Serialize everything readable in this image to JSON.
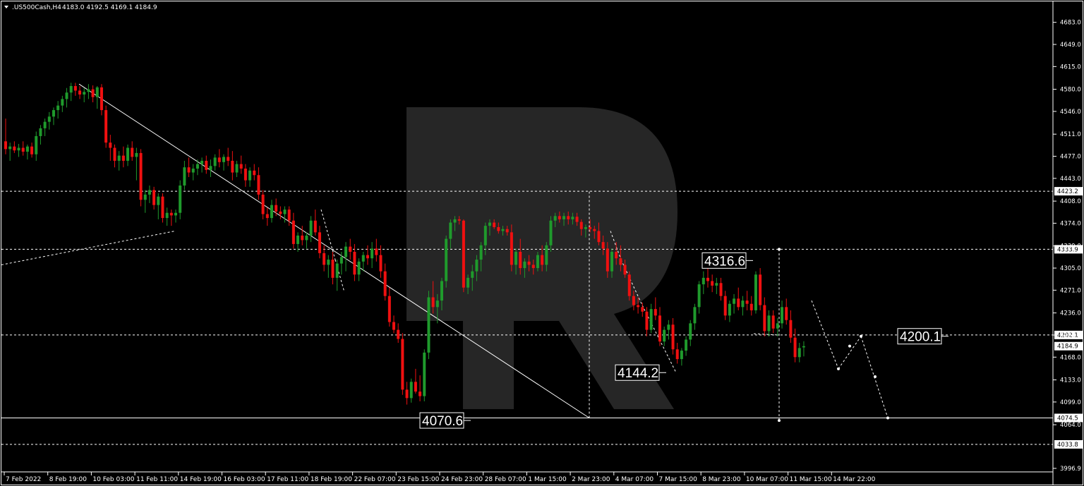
{
  "header": {
    "symbol": ".US500Cash,H4",
    "ohlc": "4183.0 4192.5 4169.1 4184.9"
  },
  "colors": {
    "background": "#000000",
    "bull": "#1f9a2c",
    "bear": "#f01010",
    "line": "#ffffff",
    "tag_bg": "#ffffff"
  },
  "chart_data": {
    "type": "candlestick",
    "timeframe": "H4",
    "ylim": [
      3996.9,
      4700
    ],
    "y_ticks": [
      "4683.0",
      "4649.0",
      "4615.0",
      "4580.0",
      "4546.0",
      "4511.0",
      "4477.0",
      "4443.0",
      "4408.0",
      "4374.0",
      "4339.0",
      "4305.0",
      "4271.0",
      "4236.0",
      "4202.0",
      "4168.0",
      "4133.0",
      "4099.0",
      "4064.0",
      "3996.9"
    ],
    "x_labels": [
      "7 Feb 2022",
      "8 Feb 19:00",
      "10 Feb 03:00",
      "11 Feb 11:00",
      "14 Feb 19:00",
      "16 Feb 03:00",
      "17 Feb 11:00",
      "18 Feb 19:00",
      "22 Feb 07:00",
      "23 Feb 15:00",
      "24 Feb 23:00",
      "28 Feb 07:00",
      "1 Mar 15:00",
      "2 Mar 23:00",
      "4 Mar 07:00",
      "7 Mar 15:00",
      "8 Mar 23:00",
      "10 Mar 07:00",
      "11 Mar 15:00",
      "14 Mar 22:00"
    ],
    "levels": [
      {
        "value": 4423.2,
        "style": "dashed",
        "tag": "4423.2"
      },
      {
        "value": 4333.9,
        "style": "dashed",
        "tag": "4333.9"
      },
      {
        "value": 4202.1,
        "style": "dashed",
        "tag": "4202.1"
      },
      {
        "value": 4074.5,
        "style": "solid",
        "tag": "4074.5"
      },
      {
        "value": 4033.8,
        "style": "dashed",
        "tag": "4033.8"
      }
    ],
    "current_price": {
      "value": 4184.9,
      "tag": "4184.9"
    },
    "annotations": [
      {
        "text": "4316.6",
        "value": 4316.6
      },
      {
        "text": "4200.1",
        "value": 4200.1
      },
      {
        "text": "4144.2",
        "value": 4144.2
      },
      {
        "text": "4070.6",
        "value": 4070.6
      }
    ],
    "candles": [
      [
        4500,
        4535,
        4480,
        4488
      ],
      [
        4488,
        4498,
        4470,
        4492
      ],
      [
        4492,
        4500,
        4482,
        4486
      ],
      [
        4486,
        4496,
        4476,
        4490
      ],
      [
        4490,
        4500,
        4478,
        4484
      ],
      [
        4484,
        4495,
        4472,
        4492
      ],
      [
        4492,
        4498,
        4475,
        4480
      ],
      [
        4480,
        4515,
        4470,
        4508
      ],
      [
        4508,
        4525,
        4495,
        4520
      ],
      [
        4520,
        4535,
        4508,
        4530
      ],
      [
        4530,
        4545,
        4518,
        4538
      ],
      [
        4538,
        4552,
        4525,
        4548
      ],
      [
        4548,
        4562,
        4535,
        4555
      ],
      [
        4555,
        4570,
        4545,
        4565
      ],
      [
        4565,
        4582,
        4552,
        4575
      ],
      [
        4575,
        4590,
        4562,
        4585
      ],
      [
        4585,
        4590,
        4570,
        4578
      ],
      [
        4578,
        4585,
        4565,
        4572
      ],
      [
        4572,
        4582,
        4560,
        4576
      ],
      [
        4576,
        4588,
        4565,
        4580
      ],
      [
        4580,
        4586,
        4560,
        4568
      ],
      [
        4568,
        4585,
        4550,
        4583
      ],
      [
        4583,
        4588,
        4540,
        4548
      ],
      [
        4548,
        4555,
        4490,
        4498
      ],
      [
        4498,
        4510,
        4470,
        4490
      ],
      [
        4490,
        4495,
        4460,
        4470
      ],
      [
        4470,
        4485,
        4455,
        4478
      ],
      [
        4478,
        4492,
        4460,
        4470
      ],
      [
        4470,
        4495,
        4462,
        4490
      ],
      [
        4490,
        4500,
        4470,
        4476
      ],
      [
        4476,
        4490,
        4440,
        4482
      ],
      [
        4482,
        4488,
        4400,
        4410
      ],
      [
        4410,
        4425,
        4390,
        4418
      ],
      [
        4418,
        4432,
        4405,
        4425
      ],
      [
        4425,
        4430,
        4395,
        4402
      ],
      [
        4402,
        4420,
        4380,
        4415
      ],
      [
        4415,
        4420,
        4375,
        4382
      ],
      [
        4382,
        4398,
        4370,
        4390
      ],
      [
        4390,
        4395,
        4370,
        4386
      ],
      [
        4386,
        4395,
        4375,
        4390
      ],
      [
        4390,
        4440,
        4380,
        4432
      ],
      [
        4432,
        4470,
        4425,
        4460
      ],
      [
        4460,
        4475,
        4445,
        4452
      ],
      [
        4452,
        4465,
        4440,
        4458
      ],
      [
        4458,
        4472,
        4448,
        4465
      ],
      [
        4465,
        4475,
        4452,
        4470
      ],
      [
        4470,
        4478,
        4450,
        4456
      ],
      [
        4456,
        4472,
        4445,
        4462
      ],
      [
        4462,
        4480,
        4455,
        4475
      ],
      [
        4475,
        4488,
        4460,
        4468
      ],
      [
        4468,
        4480,
        4455,
        4476
      ],
      [
        4476,
        4490,
        4462,
        4470
      ],
      [
        4470,
        4485,
        4440,
        4452
      ],
      [
        4452,
        4470,
        4445,
        4465
      ],
      [
        4465,
        4478,
        4450,
        4458
      ],
      [
        4458,
        4465,
        4430,
        4440
      ],
      [
        4440,
        4460,
        4430,
        4455
      ],
      [
        4455,
        4465,
        4440,
        4448
      ],
      [
        4448,
        4460,
        4410,
        4418
      ],
      [
        4418,
        4425,
        4380,
        4388
      ],
      [
        4388,
        4398,
        4370,
        4382
      ],
      [
        4382,
        4410,
        4375,
        4402
      ],
      [
        4402,
        4412,
        4385,
        4392
      ],
      [
        4392,
        4400,
        4380,
        4388
      ],
      [
        4388,
        4400,
        4375,
        4395
      ],
      [
        4395,
        4400,
        4370,
        4378
      ],
      [
        4378,
        4390,
        4335,
        4342
      ],
      [
        4342,
        4360,
        4330,
        4355
      ],
      [
        4355,
        4370,
        4340,
        4348
      ],
      [
        4348,
        4360,
        4335,
        4355
      ],
      [
        4355,
        4385,
        4345,
        4378
      ],
      [
        4378,
        4395,
        4355,
        4360
      ],
      [
        4360,
        4370,
        4320,
        4328
      ],
      [
        4328,
        4340,
        4300,
        4310
      ],
      [
        4310,
        4325,
        4290,
        4318
      ],
      [
        4318,
        4330,
        4280,
        4290
      ],
      [
        4290,
        4318,
        4270,
        4312
      ],
      [
        4312,
        4330,
        4295,
        4322
      ],
      [
        4322,
        4345,
        4300,
        4338
      ],
      [
        4338,
        4350,
        4318,
        4330
      ],
      [
        4330,
        4342,
        4285,
        4295
      ],
      [
        4295,
        4320,
        4285,
        4315
      ],
      [
        4315,
        4330,
        4300,
        4325
      ],
      [
        4325,
        4340,
        4310,
        4320
      ],
      [
        4320,
        4345,
        4305,
        4335
      ],
      [
        4335,
        4350,
        4315,
        4325
      ],
      [
        4325,
        4340,
        4290,
        4300
      ],
      [
        4300,
        4312,
        4255,
        4262
      ],
      [
        4262,
        4275,
        4215,
        4222
      ],
      [
        4222,
        4232,
        4205,
        4210
      ],
      [
        4210,
        4220,
        4190,
        4196
      ],
      [
        4196,
        4205,
        4110,
        4118
      ],
      [
        4118,
        4130,
        4095,
        4105
      ],
      [
        4105,
        4135,
        4098,
        4130
      ],
      [
        4130,
        4150,
        4112,
        4115
      ],
      [
        4115,
        4140,
        4100,
        4108
      ],
      [
        4108,
        4180,
        4100,
        4175
      ],
      [
        4175,
        4270,
        4165,
        4260
      ],
      [
        4260,
        4285,
        4235,
        4245
      ],
      [
        4245,
        4265,
        4220,
        4255
      ],
      [
        4255,
        4290,
        4240,
        4285
      ],
      [
        4285,
        4355,
        4275,
        4350
      ],
      [
        4350,
        4380,
        4335,
        4375
      ],
      [
        4375,
        4385,
        4362,
        4380
      ],
      [
        4380,
        4385,
        4372,
        4378
      ],
      [
        4378,
        4380,
        4268,
        4275
      ],
      [
        4275,
        4295,
        4265,
        4290
      ],
      [
        4290,
        4310,
        4270,
        4300
      ],
      [
        4300,
        4325,
        4285,
        4318
      ],
      [
        4318,
        4345,
        4300,
        4340
      ],
      [
        4340,
        4375,
        4325,
        4370
      ],
      [
        4370,
        4380,
        4355,
        4375
      ],
      [
        4375,
        4380,
        4365,
        4368
      ],
      [
        4368,
        4375,
        4358,
        4362
      ],
      [
        4362,
        4370,
        4355,
        4365
      ],
      [
        4365,
        4370,
        4355,
        4360
      ],
      [
        4360,
        4372,
        4300,
        4310
      ],
      [
        4310,
        4335,
        4295,
        4330
      ],
      [
        4330,
        4350,
        4295,
        4305
      ],
      [
        4305,
        4320,
        4290,
        4315
      ],
      [
        4315,
        4325,
        4300,
        4310
      ],
      [
        4310,
        4318,
        4295,
        4305
      ],
      [
        4305,
        4330,
        4300,
        4325
      ],
      [
        4325,
        4340,
        4300,
        4310
      ],
      [
        4310,
        4345,
        4300,
        4340
      ],
      [
        4340,
        4385,
        4330,
        4378
      ],
      [
        4378,
        4390,
        4368,
        4385
      ],
      [
        4385,
        4392,
        4375,
        4380
      ],
      [
        4380,
        4390,
        4370,
        4385
      ],
      [
        4385,
        4392,
        4372,
        4380
      ],
      [
        4380,
        4390,
        4372,
        4384
      ],
      [
        4384,
        4390,
        4370,
        4376
      ],
      [
        4376,
        4380,
        4355,
        4365
      ],
      [
        4365,
        4372,
        4352,
        4368
      ],
      [
        4368,
        4380,
        4360,
        4365
      ],
      [
        4365,
        4370,
        4350,
        4362
      ],
      [
        4362,
        4375,
        4340,
        4345
      ],
      [
        4345,
        4355,
        4325,
        4335
      ],
      [
        4335,
        4345,
        4290,
        4300
      ],
      [
        4300,
        4335,
        4290,
        4330
      ],
      [
        4330,
        4345,
        4310,
        4320
      ],
      [
        4320,
        4340,
        4300,
        4310
      ],
      [
        4310,
        4318,
        4290,
        4295
      ],
      [
        4295,
        4300,
        4255,
        4262
      ],
      [
        4262,
        4270,
        4240,
        4248
      ],
      [
        4248,
        4260,
        4235,
        4245
      ],
      [
        4245,
        4252,
        4230,
        4238
      ],
      [
        4238,
        4245,
        4200,
        4210
      ],
      [
        4210,
        4250,
        4205,
        4242
      ],
      [
        4242,
        4260,
        4225,
        4232
      ],
      [
        4232,
        4245,
        4185,
        4192
      ],
      [
        4192,
        4215,
        4185,
        4210
      ],
      [
        4210,
        4225,
        4195,
        4218
      ],
      [
        4218,
        4228,
        4172,
        4180
      ],
      [
        4180,
        4190,
        4158,
        4165
      ],
      [
        4165,
        4182,
        4155,
        4178
      ],
      [
        4178,
        4200,
        4170,
        4195
      ],
      [
        4195,
        4225,
        4185,
        4220
      ],
      [
        4220,
        4250,
        4210,
        4245
      ],
      [
        4245,
        4285,
        4235,
        4280
      ],
      [
        4280,
        4300,
        4265,
        4290
      ],
      [
        4290,
        4305,
        4275,
        4285
      ],
      [
        4285,
        4295,
        4268,
        4278
      ],
      [
        4278,
        4290,
        4265,
        4282
      ],
      [
        4282,
        4290,
        4255,
        4262
      ],
      [
        4262,
        4270,
        4225,
        4232
      ],
      [
        4232,
        4255,
        4222,
        4250
      ],
      [
        4250,
        4265,
        4235,
        4258
      ],
      [
        4258,
        4275,
        4240,
        4245
      ],
      [
        4245,
        4262,
        4232,
        4255
      ],
      [
        4255,
        4270,
        4240,
        4250
      ],
      [
        4250,
        4262,
        4232,
        4240
      ],
      [
        4240,
        4300,
        4235,
        4295
      ],
      [
        4295,
        4305,
        4240,
        4248
      ],
      [
        4248,
        4260,
        4200,
        4208
      ],
      [
        4208,
        4240,
        4200,
        4232
      ],
      [
        4232,
        4240,
        4205,
        4212
      ],
      [
        4212,
        4228,
        4200,
        4220
      ],
      [
        4220,
        4255,
        4212,
        4245
      ],
      [
        4245,
        4258,
        4218,
        4225
      ],
      [
        4225,
        4240,
        4190,
        4198
      ],
      [
        4198,
        4212,
        4160,
        4168
      ],
      [
        4168,
        4190,
        4160,
        4182
      ],
      [
        4183,
        4192.5,
        4169.1,
        4184.9
      ]
    ]
  }
}
